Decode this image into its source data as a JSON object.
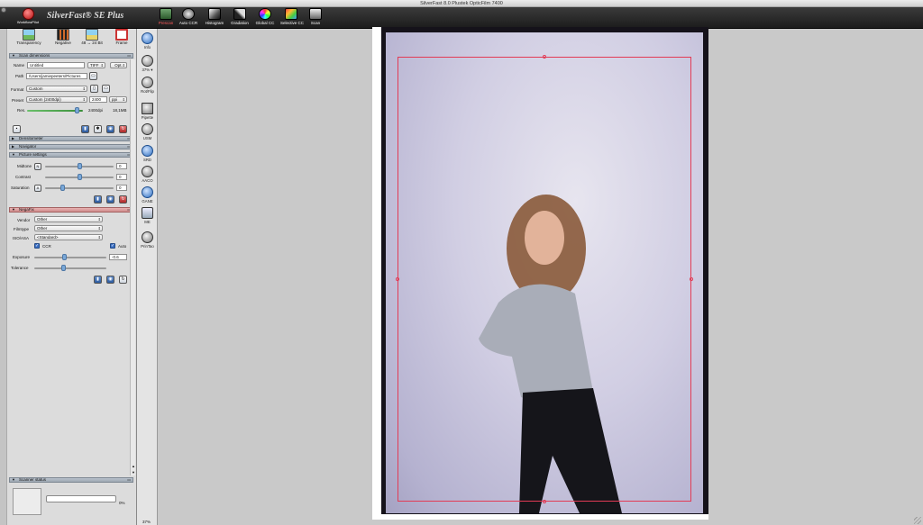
{
  "window": {
    "title": "SilverFast 8.0 Plustek OpticFilm 7400"
  },
  "brand": {
    "workflow_label": "WorkflowPilot",
    "logo_text": "SilverFast® SE Plus"
  },
  "toolbar": {
    "items": [
      "Prescan",
      "Auto CCR",
      "Histogram",
      "Gradation",
      "Global CC",
      "Selective CC",
      "Scan"
    ]
  },
  "modes": [
    "Transparency",
    "Negative",
    "48 → 24 Bit",
    "Frame"
  ],
  "scan_dimensions": {
    "header": "Scan dimensions",
    "name_label": "Name",
    "name_value": "Untitled",
    "format_type": "TIFF",
    "opt_label": "Opt.",
    "path_label": "Path",
    "path_value": "/Users/jamiepeeters/Pictures",
    "format_label": "Format",
    "format_value": "Custom",
    "preset_label": "Preset",
    "preset_value": "Custom (2400dpi)",
    "ppi_value": "2400",
    "ppi_unit": "ppi",
    "res_label": "Res.",
    "res_value": "2400dpi",
    "size_value": "18,1MB"
  },
  "sections": {
    "densitometer": "Densitometer",
    "navigator": "Navigator",
    "picture_settings": "Picture settings",
    "negafix": "NegaFix",
    "scanner_status": "Scanner status"
  },
  "picture_settings": {
    "midtone_label": "Midtone",
    "midtone_badge": "N",
    "midtone_value": "0",
    "contrast_label": "Contrast",
    "contrast_value": "0",
    "saturation_label": "Saturation",
    "saturation_badge": "A",
    "saturation_value": "0"
  },
  "negafix": {
    "vendor_label": "Vendor",
    "vendor_value": "Other",
    "filmtype_label": "Filmtype",
    "filmtype_value": "Other",
    "iso_label": "ISO/ASA",
    "iso_value": "<Standard>",
    "ccr_label": "CCR",
    "auto_label": "Auto",
    "exposure_label": "Exposure",
    "exposure_value": "-0.6",
    "tolerance_label": "Tolerance"
  },
  "scanner_status": {
    "progress_text": "0%",
    "progress": 0
  },
  "side_tools": [
    "Info",
    "37% ▾",
    "Rot/Flip",
    "Pipette",
    "USM",
    "SRD",
    "AACO",
    "GANE",
    "ME",
    "PrinTao"
  ],
  "footer": {
    "zoom": "37%"
  }
}
